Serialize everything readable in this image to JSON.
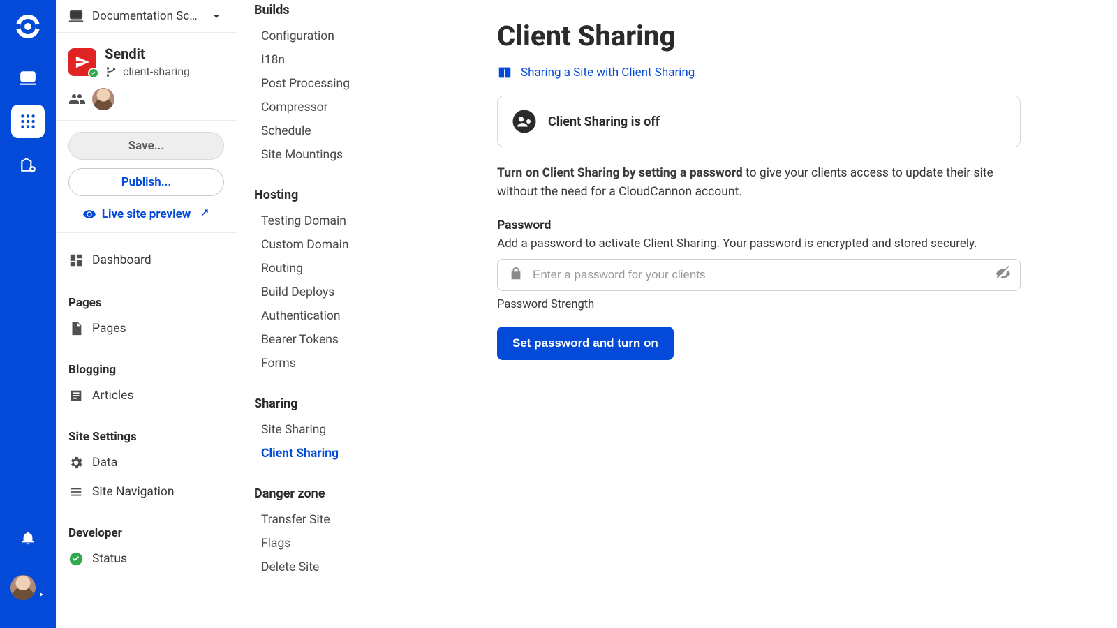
{
  "rail": {
    "icons": [
      "laptop-icon",
      "apps-icon",
      "org-icon"
    ]
  },
  "project_switcher": {
    "label": "Documentation Scr…"
  },
  "site": {
    "name": "Sendit",
    "branch": "client-sharing"
  },
  "actions": {
    "save": "Save...",
    "publish": "Publish...",
    "preview": "Live site preview"
  },
  "sidebar_nav": {
    "dashboard": "Dashboard",
    "groups": [
      {
        "title": "Pages",
        "items": [
          {
            "icon": "page-icon",
            "label": "Pages"
          }
        ]
      },
      {
        "title": "Blogging",
        "items": [
          {
            "icon": "article-icon",
            "label": "Articles"
          }
        ]
      },
      {
        "title": "Site Settings",
        "items": [
          {
            "icon": "gear-icon",
            "label": "Data"
          },
          {
            "icon": "list-icon",
            "label": "Site Navigation"
          }
        ]
      },
      {
        "title": "Developer",
        "items": [
          {
            "icon": "check-circle-icon",
            "label": "Status"
          }
        ]
      }
    ]
  },
  "settings": {
    "groups": [
      {
        "title": "Builds",
        "items": [
          "Configuration",
          "I18n",
          "Post Processing",
          "Compressor",
          "Schedule",
          "Site Mountings"
        ]
      },
      {
        "title": "Hosting",
        "items": [
          "Testing Domain",
          "Custom Domain",
          "Routing",
          "Build Deploys",
          "Authentication",
          "Bearer Tokens",
          "Forms"
        ]
      },
      {
        "title": "Sharing",
        "items": [
          "Site Sharing",
          "Client Sharing"
        ],
        "active": "Client Sharing"
      },
      {
        "title": "Danger zone",
        "items": [
          "Transfer Site",
          "Flags",
          "Delete Site"
        ]
      }
    ]
  },
  "main": {
    "title": "Client Sharing",
    "doc_link": "Sharing a Site with Client Sharing",
    "status": "Client Sharing is off",
    "desc_bold": "Turn on Client Sharing by setting a password",
    "desc_rest": " to give your clients access to update their site without the need for a CloudCannon account.",
    "password_label": "Password",
    "password_help": "Add a password to activate Client Sharing. Your password is encrypted and stored securely.",
    "password_placeholder": "Enter a password for your clients",
    "strength_label": "Password Strength",
    "submit": "Set password and turn on"
  }
}
